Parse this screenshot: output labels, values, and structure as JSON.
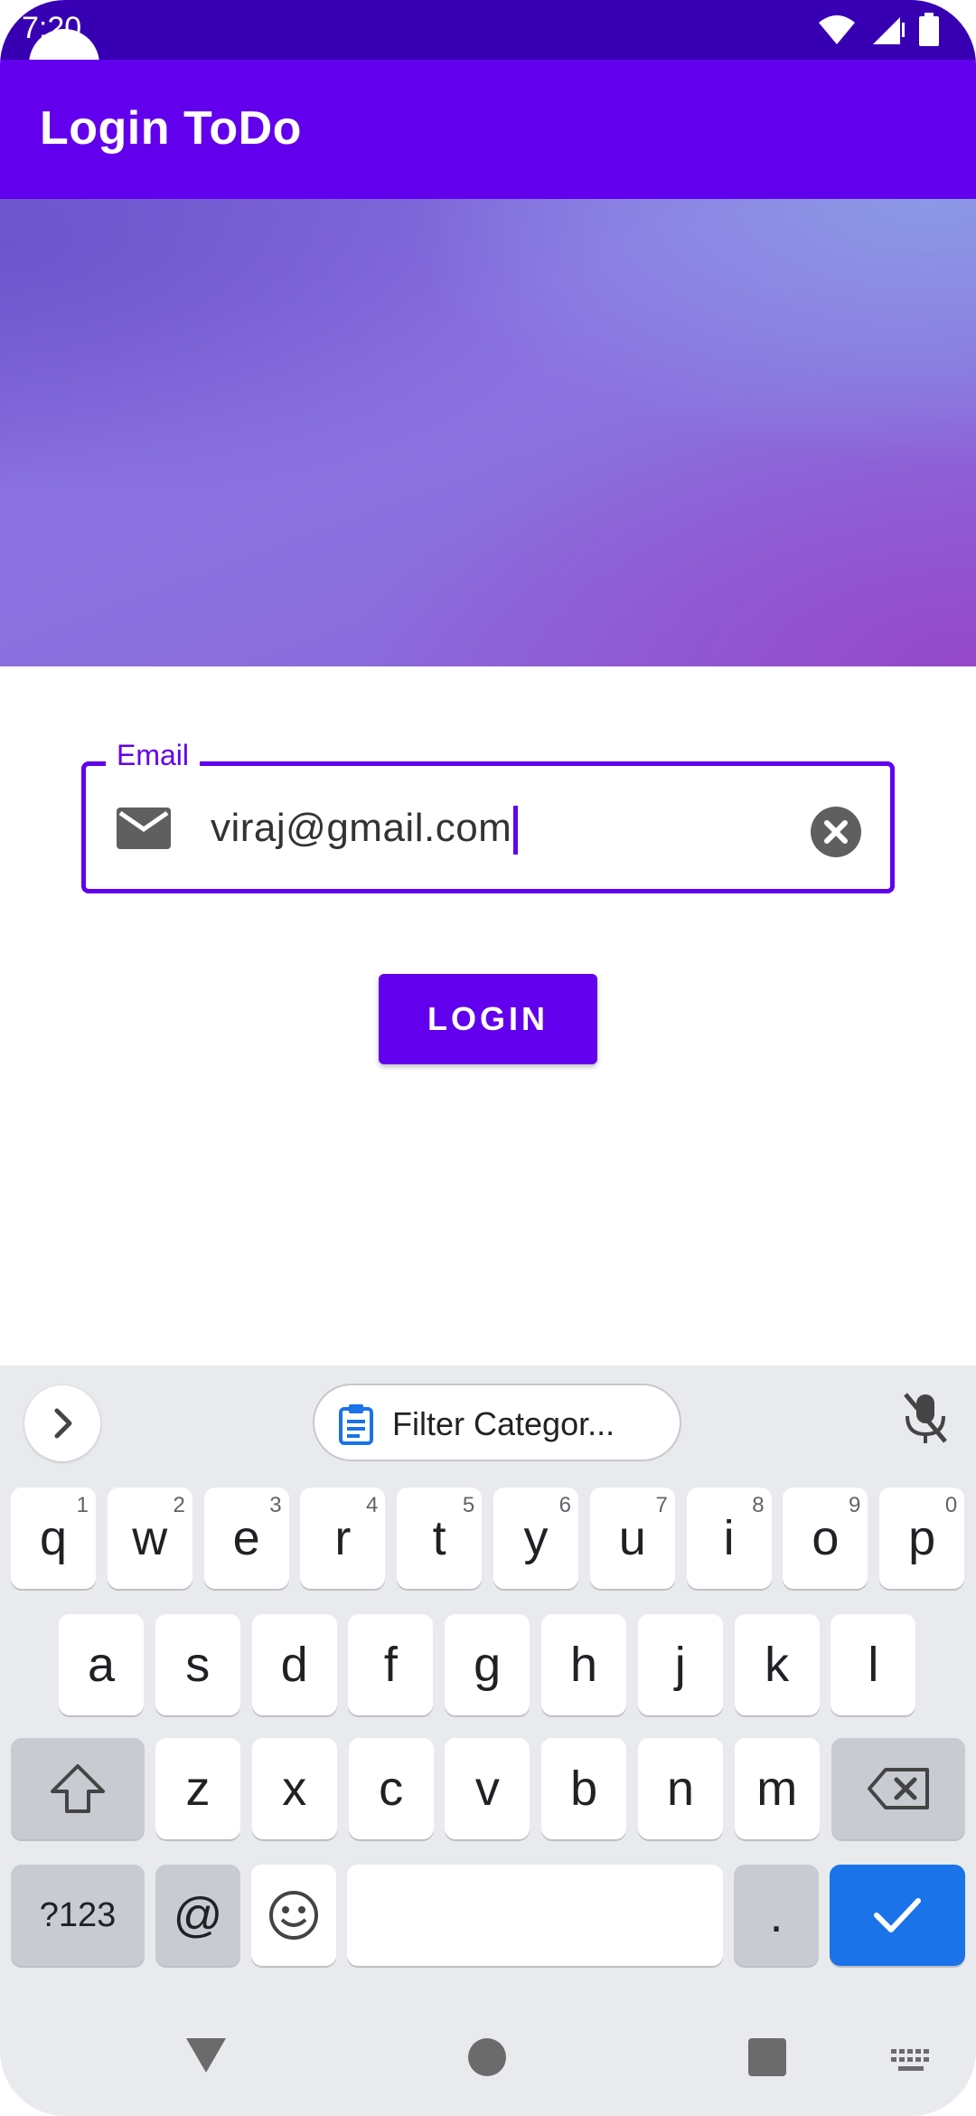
{
  "status_bar": {
    "time": "7:20"
  },
  "app_bar": {
    "title": "Login ToDo"
  },
  "form": {
    "email_label": "Email",
    "email_value": "viraj@gmail.com",
    "login_label": "LOGIN"
  },
  "keyboard": {
    "suggestion_chip": "Filter Categor...",
    "row1": [
      {
        "char": "q",
        "hint": "1"
      },
      {
        "char": "w",
        "hint": "2"
      },
      {
        "char": "e",
        "hint": "3"
      },
      {
        "char": "r",
        "hint": "4"
      },
      {
        "char": "t",
        "hint": "5"
      },
      {
        "char": "y",
        "hint": "6"
      },
      {
        "char": "u",
        "hint": "7"
      },
      {
        "char": "i",
        "hint": "8"
      },
      {
        "char": "o",
        "hint": "9"
      },
      {
        "char": "p",
        "hint": "0"
      }
    ],
    "row2": [
      "a",
      "s",
      "d",
      "f",
      "g",
      "h",
      "j",
      "k",
      "l"
    ],
    "row3": [
      "z",
      "x",
      "c",
      "v",
      "b",
      "n",
      "m"
    ],
    "symbols_label": "?123",
    "at_label": "@",
    "period_label": "."
  },
  "colors": {
    "primary": "#6200ee",
    "primary_dark": "#3700b3",
    "keyboard_bg": "#e8eaed",
    "action_key": "#1a73e8"
  },
  "icons": {
    "email_field": "mail-icon",
    "clear": "clear-circle-icon",
    "chip": "clipboard-icon",
    "mic": "mic-off-icon"
  }
}
